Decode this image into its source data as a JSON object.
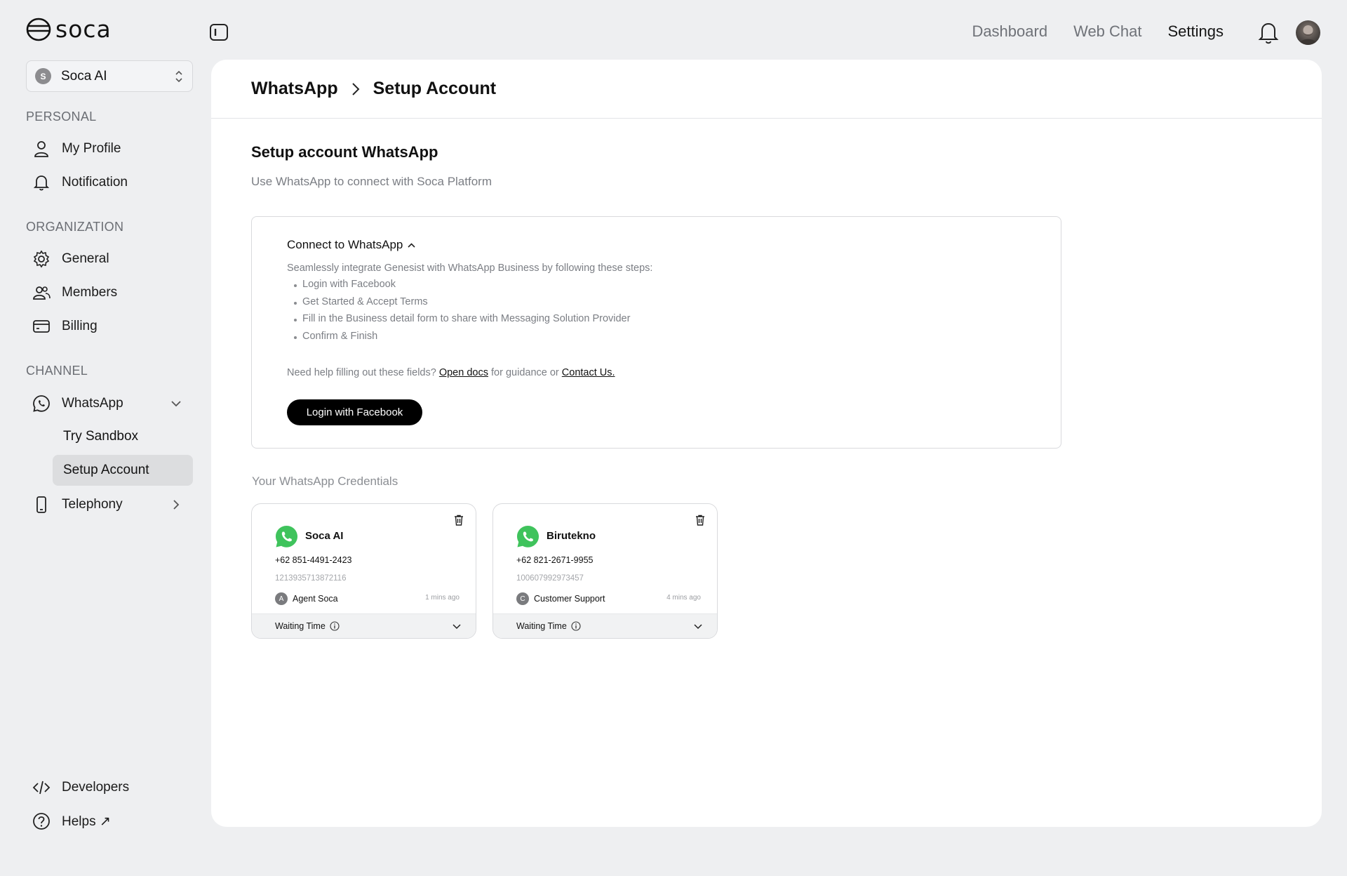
{
  "brand": {
    "name": "soca"
  },
  "org_selector": {
    "badge": "S",
    "name": "Soca AI"
  },
  "sidebar": {
    "personal_title": "PERSONAL",
    "organization_title": "ORGANIZATION",
    "channel_title": "CHANNEL",
    "personal": [
      {
        "label": "My Profile",
        "icon": "user-icon"
      },
      {
        "label": "Notification",
        "icon": "bell-icon"
      }
    ],
    "organization": [
      {
        "label": "General",
        "icon": "gear-icon"
      },
      {
        "label": "Members",
        "icon": "users-icon"
      },
      {
        "label": "Billing",
        "icon": "card-icon"
      }
    ],
    "channel": {
      "whatsapp": {
        "label": "WhatsApp",
        "icon": "whatsapp-icon"
      },
      "try_sandbox": "Try Sandbox",
      "setup_account": "Setup Account",
      "telephony": {
        "label": "Telephony",
        "icon": "phone-icon"
      }
    },
    "developers": "Developers",
    "helps": "Helps ↗"
  },
  "topnav": {
    "dashboard": "Dashboard",
    "web_chat": "Web Chat",
    "settings": "Settings"
  },
  "breadcrumb": {
    "parent": "WhatsApp",
    "current": "Setup Account"
  },
  "page": {
    "title": "Setup account WhatsApp",
    "subtitle": "Use WhatsApp to connect with Soca Platform"
  },
  "connect": {
    "title": "Connect to WhatsApp",
    "description": "Seamlessly integrate Genesist with WhatsApp Business by following these steps:",
    "steps": [
      "Login with Facebook",
      "Get Started & Accept Terms",
      "Fill in the Business detail form to share with Messaging Solution Provider",
      "Confirm & Finish"
    ],
    "help_prefix": "Need help filling out these fields?",
    "help_docs": "Open docs",
    "help_middle": "for guidance or",
    "help_contact": "Contact Us.",
    "button": "Login with Facebook"
  },
  "credentials": {
    "title": "Your WhatsApp Credentials",
    "cards": [
      {
        "name": "Soca AI",
        "phone": "+62 851-4491-2423",
        "id": "1213935713872116",
        "agent_badge": "A",
        "agent": "Agent Soca",
        "ago": "1 mins ago",
        "waiting": "Waiting Time"
      },
      {
        "name": "Birutekno",
        "phone": "+62 821-2671-9955",
        "id": "100607992973457",
        "agent_badge": "C",
        "agent": "Customer Support",
        "ago": "4 mins ago",
        "waiting": "Waiting Time"
      }
    ]
  },
  "colors": {
    "accent": "#000000",
    "whatsapp_green": "#3fc35c",
    "panel_bg": "#ffffff",
    "page_bg": "#eeeff1",
    "active_item": "#dcdddf"
  }
}
